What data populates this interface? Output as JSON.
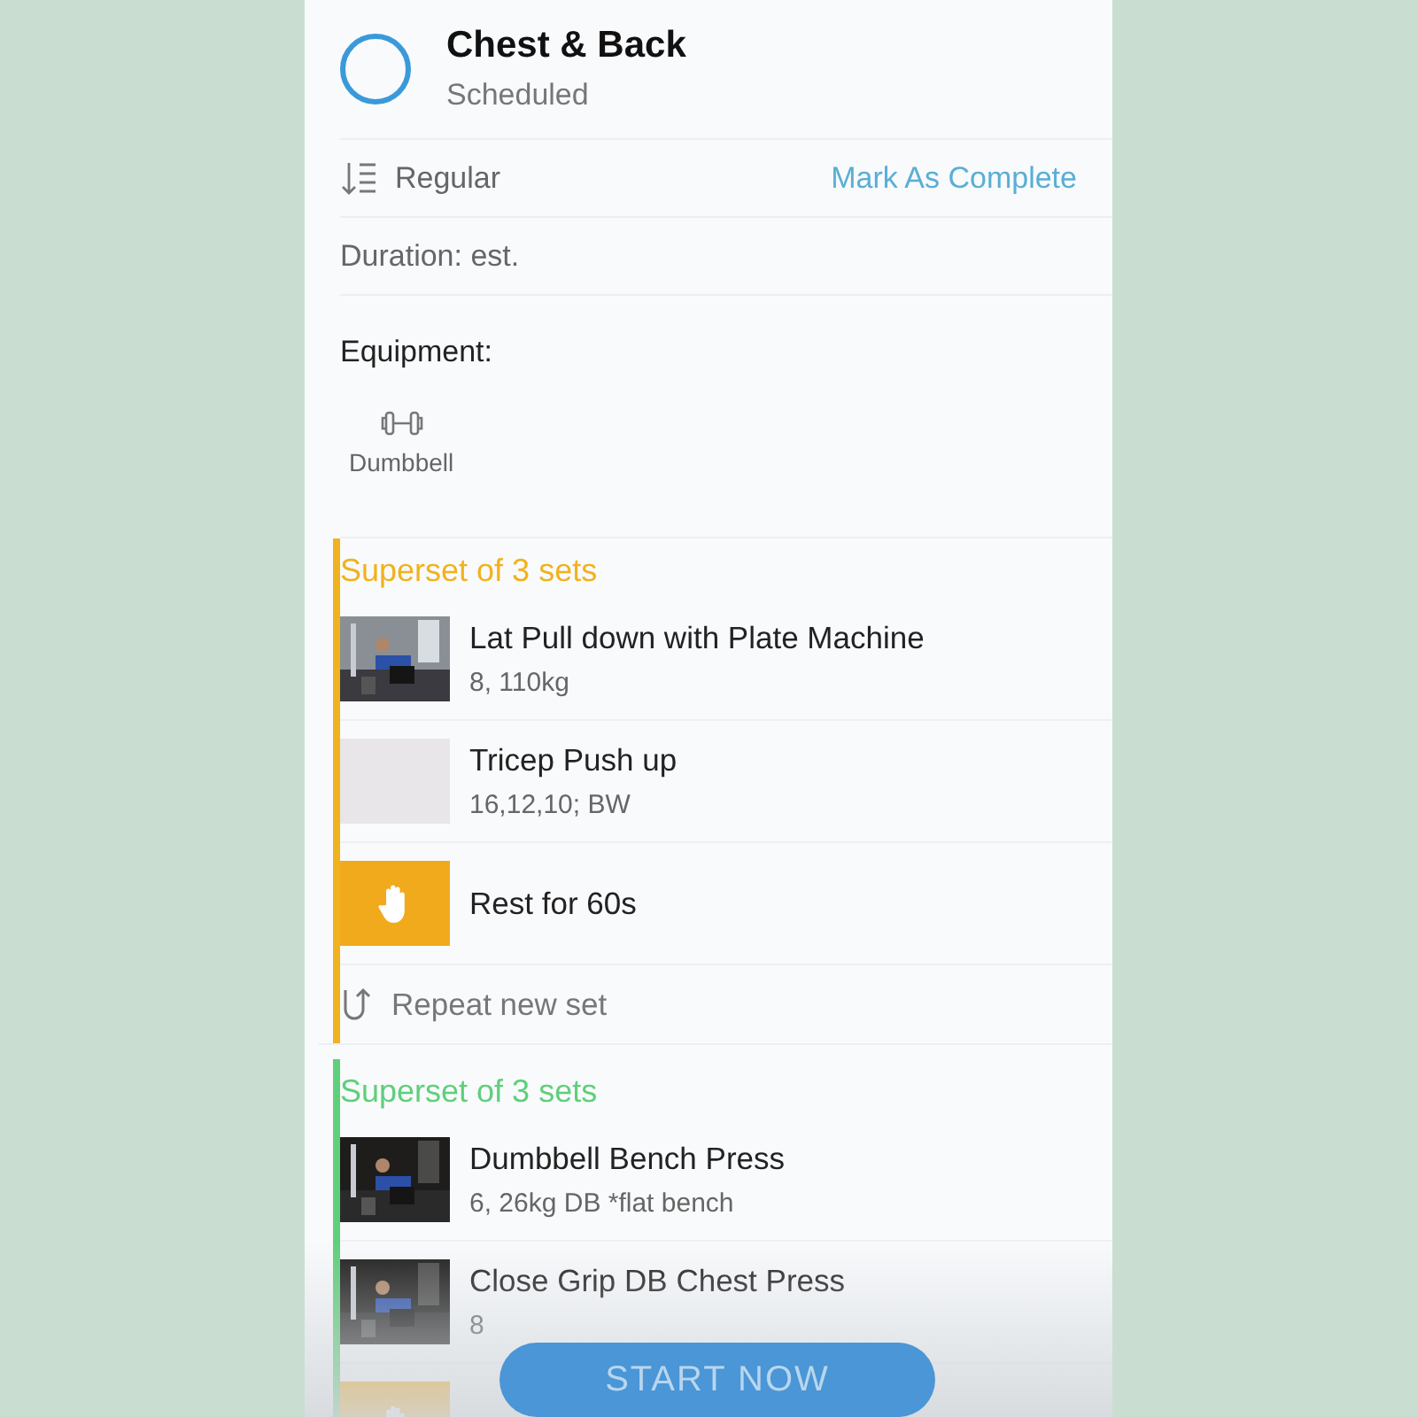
{
  "workout": {
    "title": "Chest & Back",
    "status": "Scheduled",
    "completed": false
  },
  "mode": {
    "label": "Regular",
    "action": "Mark As Complete"
  },
  "duration": "Duration: est.",
  "equipment": {
    "heading": "Equipment:",
    "items": [
      {
        "label": "Dumbbell"
      }
    ]
  },
  "supersets": [
    {
      "title": "Superset of 3 sets",
      "color": "#f0b21e",
      "repeat": "Repeat new set",
      "items": [
        {
          "name": "Lat Pull down with Plate Machine",
          "detail": "8, 110kg"
        },
        {
          "kind": "blank",
          "name": "Tricep Push up",
          "detail": "16,12,10; BW"
        },
        {
          "kind": "rest",
          "name": "Rest for 60s"
        }
      ]
    },
    {
      "title": "Superset of 3 sets",
      "color": "#5fcf7a",
      "items": [
        {
          "name": "Dumbbell Bench Press",
          "detail": "6, 26kg DB *flat bench"
        },
        {
          "name": "Close Grip DB Chest Press",
          "detail": "8"
        },
        {
          "kind": "rest"
        }
      ]
    }
  ],
  "start_button": "START NOW"
}
